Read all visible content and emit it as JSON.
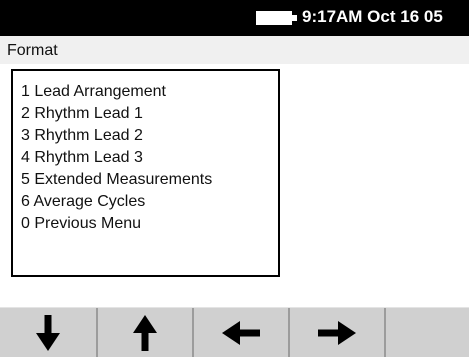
{
  "status_bar": {
    "time_date": "9:17AM Oct 16 05",
    "battery_icon": "battery-icon"
  },
  "title_bar": {
    "title": "Format"
  },
  "menu": {
    "items": [
      {
        "label": "1 Lead Arrangement"
      },
      {
        "label": "2 Rhythm Lead 1"
      },
      {
        "label": "3 Rhythm Lead 2"
      },
      {
        "label": "4 Rhythm Lead 3"
      },
      {
        "label": "5 Extended Measurements"
      },
      {
        "label": "6 Average Cycles"
      },
      {
        "label": "0 Previous Menu"
      }
    ]
  },
  "soft_keys": [
    {
      "icon": "arrow-down-icon"
    },
    {
      "icon": "arrow-up-icon"
    },
    {
      "icon": "arrow-left-icon"
    },
    {
      "icon": "arrow-right-icon"
    },
    {
      "icon": ""
    }
  ],
  "colors": {
    "status_bar_bg": "#000000",
    "title_bar_bg": "#f0f0f0",
    "soft_key_bg": "#d0d0d0"
  }
}
